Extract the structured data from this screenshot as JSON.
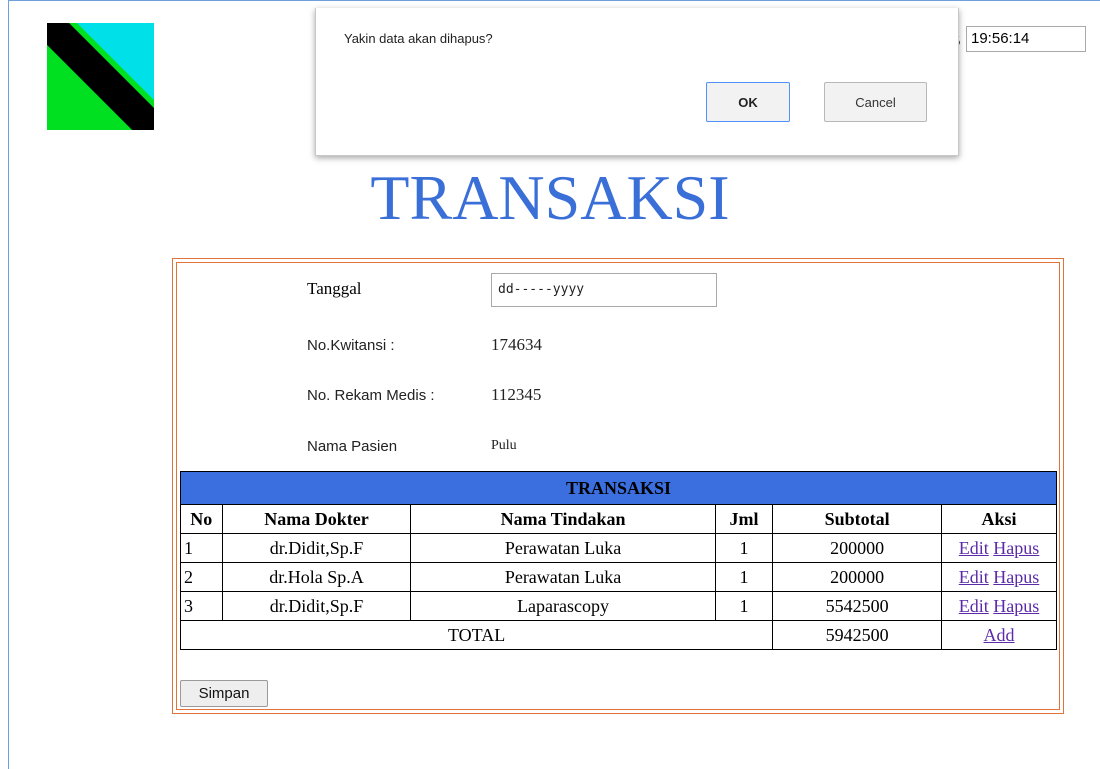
{
  "dialog": {
    "message": "Yakin data akan dihapus?",
    "ok_label": "OK",
    "cancel_label": "Cancel"
  },
  "clock": {
    "partial": "5",
    "time": "19:56:14"
  },
  "title": "TRANSAKSI",
  "form": {
    "tanggal_label": "Tanggal",
    "tanggal_placeholder": "dd-----yyyy",
    "kwitansi_label": "No.Kwitansi :",
    "kwitansi_value": "174634",
    "rekam_label": "No. Rekam Medis :",
    "rekam_value": "112345",
    "pasien_label": "Nama Pasien",
    "pasien_value": "Pulu"
  },
  "table": {
    "title": "TRANSAKSI",
    "headers": [
      "No",
      "Nama Dokter",
      "Nama Tindakan",
      "Jml",
      "Subtotal",
      "Aksi"
    ],
    "rows": [
      {
        "no": "1",
        "dokter": "dr.Didit,Sp.F",
        "tindakan": "Perawatan Luka",
        "jml": "1",
        "subtotal": "200000",
        "edit": "Edit",
        "hapus": "Hapus"
      },
      {
        "no": "2",
        "dokter": "dr.Hola Sp.A",
        "tindakan": "Perawatan Luka",
        "jml": "1",
        "subtotal": "200000",
        "edit": "Edit",
        "hapus": "Hapus"
      },
      {
        "no": "3",
        "dokter": "dr.Didit,Sp.F",
        "tindakan": "Laparascopy",
        "jml": "1",
        "subtotal": "5542500",
        "edit": "Edit",
        "hapus": "Hapus"
      }
    ],
    "total_label": "TOTAL",
    "total_value": "5942500",
    "add_label": "Add"
  },
  "simpan_label": "Simpan",
  "colors": {
    "title": "#3a6fd8",
    "table_header": "#3b6fe0",
    "form_border": "#e0733a",
    "link": "#5a2aa8"
  }
}
